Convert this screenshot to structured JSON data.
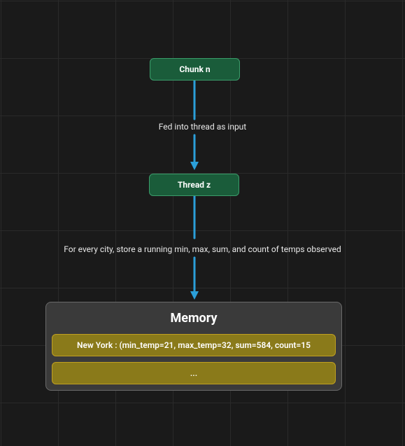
{
  "nodes": {
    "chunk": {
      "label": "Chunk n"
    },
    "thread": {
      "label": "Thread z"
    }
  },
  "edges": {
    "chunk_to_thread": {
      "label": "Fed into thread as input"
    },
    "thread_to_memory": {
      "label": "For every city, store a running min, max, sum, and count of temps observed"
    }
  },
  "memory": {
    "title": "Memory",
    "rows": [
      "New York : (min_temp=21, max_temp=32, sum=584, count=15",
      "..."
    ]
  },
  "colors": {
    "bg": "#1a1a1a",
    "grid": "#2a2a2a",
    "node_fill": "#1a5c3a",
    "node_border": "#3a9c6a",
    "arrow": "#2b9fd9",
    "memory_fill": "#3a3a3a",
    "memory_border": "#6a6a6a",
    "row_fill": "#8a7a1a",
    "row_border": "#c0a020"
  }
}
